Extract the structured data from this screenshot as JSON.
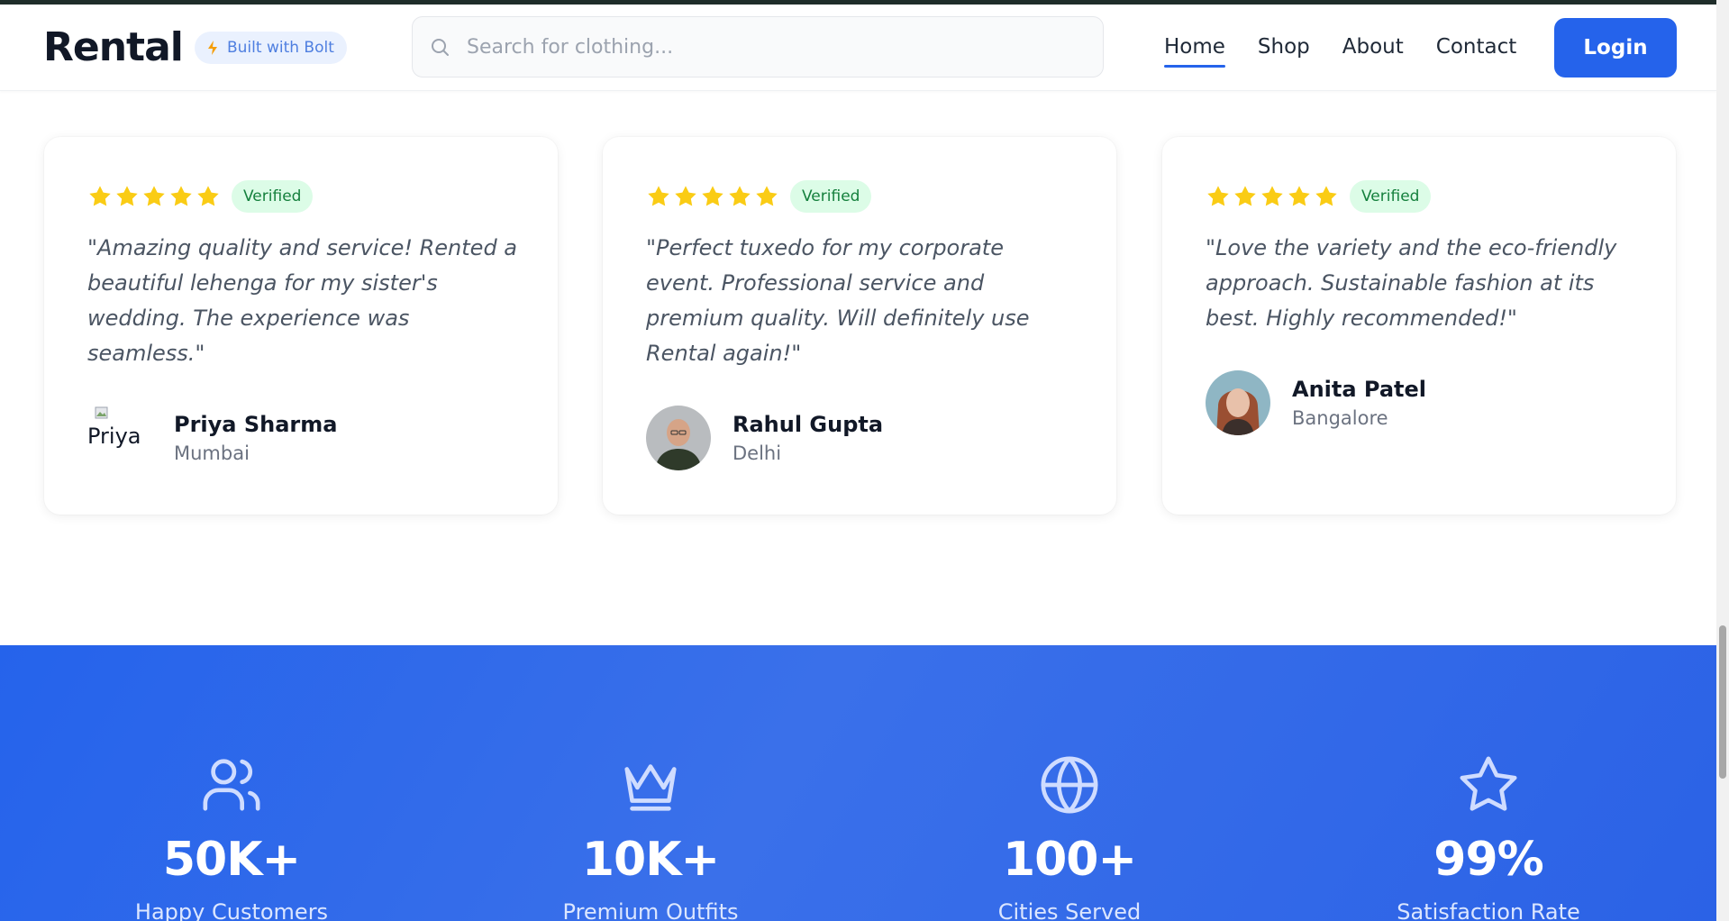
{
  "header": {
    "logo": "Rental",
    "badge": "Built with Bolt",
    "search_placeholder": "Search for clothing...",
    "nav": [
      "Home",
      "Shop",
      "About",
      "Contact"
    ],
    "active_nav": "Home",
    "login": "Login"
  },
  "testimonials": [
    {
      "rating": 5,
      "badge": "Verified",
      "quote": "\"Amazing quality and service! Rented a beautiful lehenga for my sister's wedding. The experience was seamless.\"",
      "name": "Priya Sharma",
      "city": "Mumbai",
      "avatar_alt": "Priya"
    },
    {
      "rating": 5,
      "badge": "Verified",
      "quote": "\"Perfect tuxedo for my corporate event. Professional service and premium quality. Will definitely use Rental again!\"",
      "name": "Rahul Gupta",
      "city": "Delhi"
    },
    {
      "rating": 5,
      "badge": "Verified",
      "quote": "\"Love the variety and the eco-friendly approach. Sustainable fashion at its best. Highly recommended!\"",
      "name": "Anita Patel",
      "city": "Bangalore"
    }
  ],
  "stats": [
    {
      "icon": "users-icon",
      "value": "50K+",
      "label": "Happy Customers"
    },
    {
      "icon": "crown-icon",
      "value": "10K+",
      "label": "Premium Outfits"
    },
    {
      "icon": "globe-icon",
      "value": "100+",
      "label": "Cities Served"
    },
    {
      "icon": "star-outline-icon",
      "value": "99%",
      "label": "Satisfaction Rate"
    }
  ],
  "colors": {
    "primary": "#2563eb",
    "star": "#facc15",
    "verified_bg": "#dcfce7",
    "verified_text": "#15803d"
  }
}
